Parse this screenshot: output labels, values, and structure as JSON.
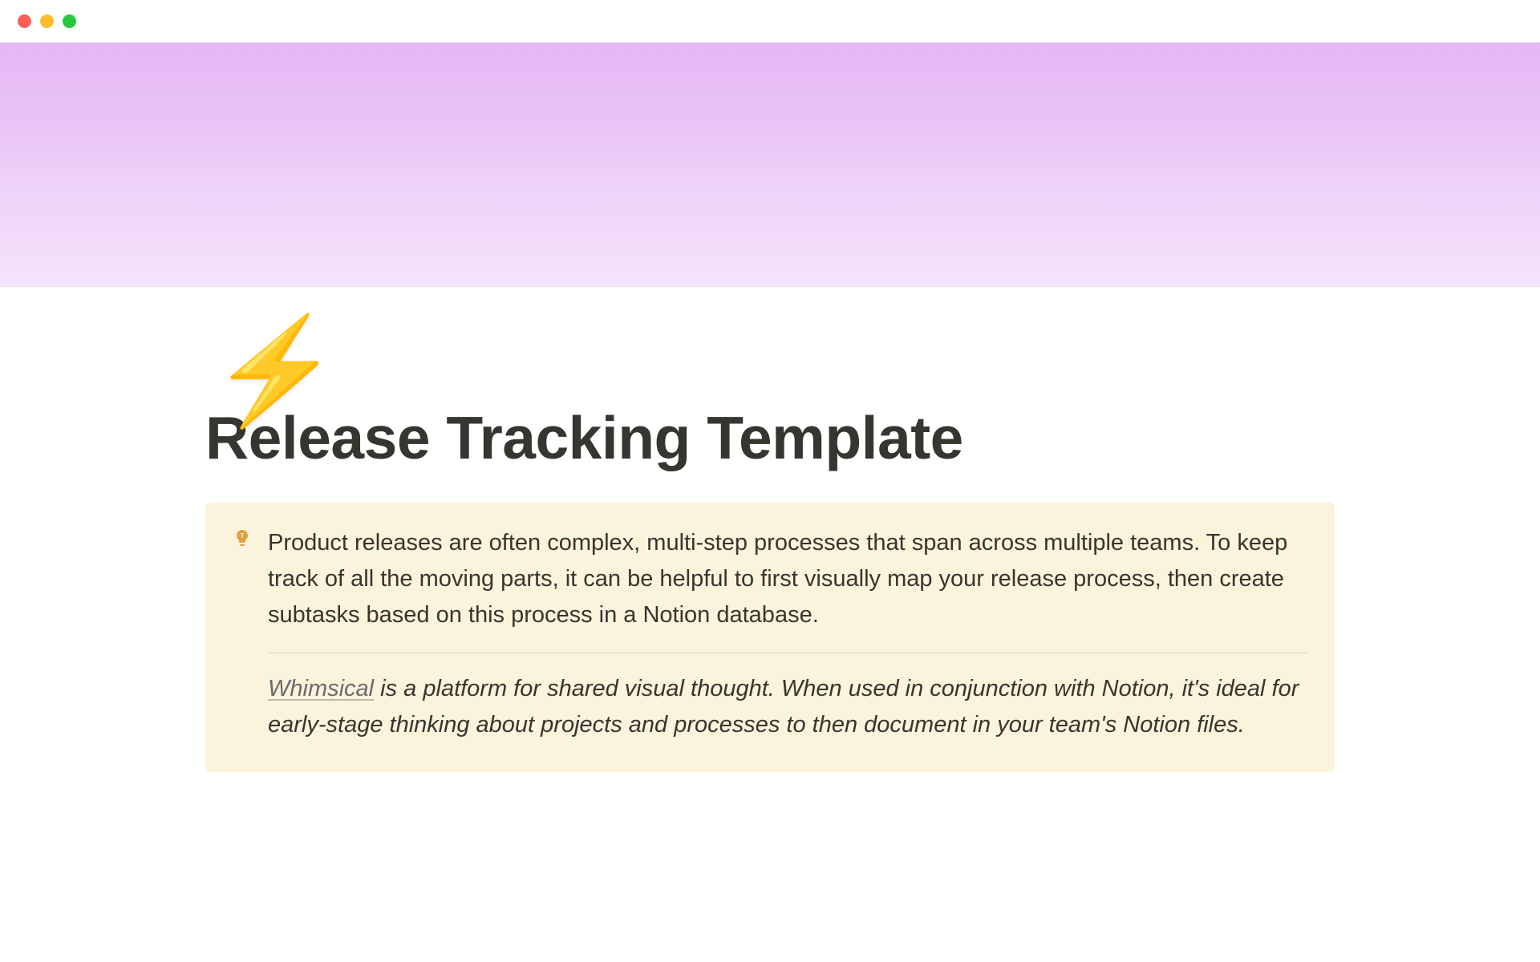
{
  "page": {
    "icon": "⚡",
    "title": "Release Tracking Template"
  },
  "callout": {
    "paragraph1": "Product releases are often complex, multi-step processes that span across multiple teams. To keep track of all the moving parts, it can be helpful to first visually map your release process, then create subtasks based on this process in a Notion database.",
    "link_text": "Whimsical",
    "paragraph2_rest": " is a platform for shared visual thought. When used in conjunction with Notion, it's ideal for early-stage thinking about projects and processes to then document in your team's Notion files."
  }
}
